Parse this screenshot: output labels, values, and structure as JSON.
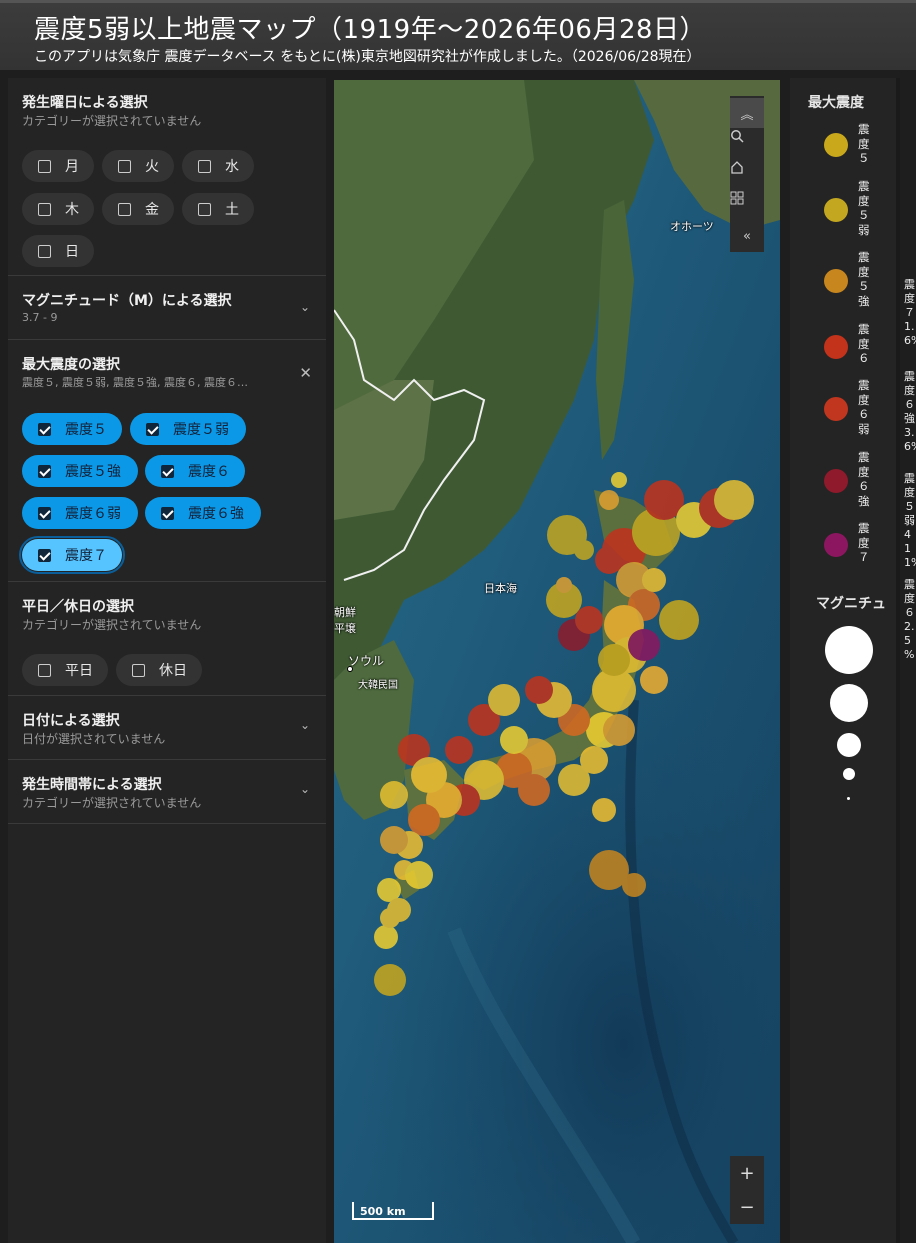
{
  "header": {
    "title": "震度5弱以上地震マップ（1919年〜2026年06月28日）",
    "subtitle": "このアプリは気象庁 震度データベース をもとに(株)東京地図研究社が作成しました。（2026/06/28現在）"
  },
  "filters": {
    "weekday": {
      "title": "発生曜日による選択",
      "subtitle": "カテゴリーが選択されていません",
      "days": [
        "月",
        "火",
        "水",
        "木",
        "金",
        "土",
        "日"
      ]
    },
    "magnitude": {
      "title": "マグニチュード（M）による選択",
      "range": "3.7 - 9"
    },
    "intensity": {
      "title": "最大震度の選択",
      "subtitle": "震度５, 震度５弱, 震度５強, 震度６, 震度６…",
      "options": [
        "震度５",
        "震度５弱",
        "震度５強",
        "震度６",
        "震度６弱",
        "震度６強",
        "震度７"
      ]
    },
    "holiday": {
      "title": "平日／休日の選択",
      "subtitle": "カテゴリーが選択されていません",
      "options": [
        "平日",
        "休日"
      ]
    },
    "date": {
      "title": "日付による選択",
      "subtitle": "日付が選択されていません"
    },
    "timeband": {
      "title": "発生時間帯による選択",
      "subtitle": "カテゴリーが選択されていません"
    }
  },
  "map": {
    "labels": {
      "okhotsk": "オホーツ",
      "japan_sea": "日本海",
      "nk1": "朝鮮",
      "nk2": "平壌",
      "seoul": "ソウル",
      "korea": "大韓民国"
    },
    "scale": "500 km",
    "tools": [
      "chevrons-up-icon",
      "search-icon",
      "home-icon",
      "qr-grid-icon",
      "chevrons-left-icon"
    ],
    "zoom_in": "+",
    "zoom_out": "−"
  },
  "legend": {
    "title": "最大震度",
    "items": [
      {
        "label": "震度５",
        "color": "#c9a81c"
      },
      {
        "label": "震度５弱",
        "color": "#c4a720"
      },
      {
        "label": "震度５強",
        "color": "#c8861e"
      },
      {
        "label": "震度６",
        "color": "#c3321b"
      },
      {
        "label": "震度６弱",
        "color": "#c0361e"
      },
      {
        "label": "震度６強",
        "color": "#8f1a2b"
      },
      {
        "label": "震度７",
        "color": "#8c1760"
      }
    ],
    "magnitude_title": "マグニチュ",
    "clipped_column": [
      "震度７ 1. 6%",
      "震度６強 3. 6%",
      "震度５弱 41 1%",
      "震度６ 2.5 %"
    ]
  },
  "colors": {
    "accent": "#0b98e6",
    "panel": "#242424",
    "background": "#1e1e1e"
  }
}
